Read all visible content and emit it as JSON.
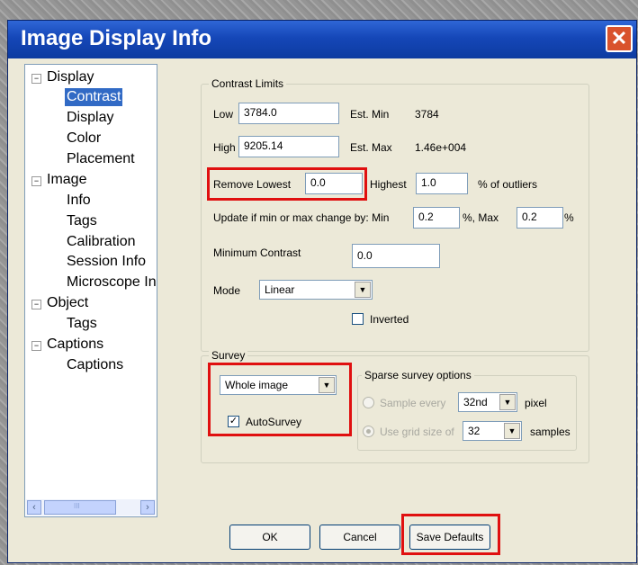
{
  "window": {
    "title": "Image Display Info",
    "close_label": "✕"
  },
  "tree": {
    "items": [
      {
        "label": "Display",
        "toggle": "−"
      },
      {
        "label": "Contrast"
      },
      {
        "label": "Display"
      },
      {
        "label": "Color"
      },
      {
        "label": "Placement"
      },
      {
        "label": "Image",
        "toggle": "−"
      },
      {
        "label": "Info"
      },
      {
        "label": "Tags"
      },
      {
        "label": "Calibration"
      },
      {
        "label": "Session Info"
      },
      {
        "label": "Microscope In"
      },
      {
        "label": "Object",
        "toggle": "−"
      },
      {
        "label": "Tags"
      },
      {
        "label": "Captions",
        "toggle": "−"
      },
      {
        "label": "Captions"
      }
    ],
    "scroll_left": "‹",
    "scroll_right": "›",
    "scroll_grip": "III"
  },
  "contrast": {
    "legend": "Contrast Limits",
    "low_label": "Low",
    "low_value": "3784.0",
    "est_min_label": "Est. Min",
    "est_min_value": "3784",
    "high_label": "High",
    "high_value": "9205.14",
    "est_max_label": "Est. Max",
    "est_max_value": "1.46e+004",
    "remove_lowest_label": "Remove Lowest",
    "remove_lowest_value": "0.0",
    "highest_label": "Highest",
    "highest_value": "1.0",
    "outliers_label": "% of outliers",
    "update_label": "Update if min or max change by: Min",
    "update_min_value": "0.2",
    "update_max_label": "%,  Max",
    "update_max_value": "0.2",
    "update_pct": "%",
    "min_contrast_label": "Minimum Contrast",
    "min_contrast_value": "0.0",
    "mode_label": "Mode",
    "mode_value": "Linear",
    "inverted_label": "Inverted"
  },
  "survey": {
    "legend": "Survey",
    "scope_value": "Whole image",
    "autosurvey_label": "AutoSurvey",
    "autosurvey_check": "✓",
    "sparse_legend": "Sparse survey options",
    "sample_every_label": "Sample every",
    "sample_every_value": "32nd",
    "pixel_label": "pixel",
    "grid_size_label": "Use grid size of",
    "grid_size_value": "32",
    "samples_label": "samples"
  },
  "buttons": {
    "ok": "OK",
    "cancel": "Cancel",
    "save_defaults": "Save Defaults"
  },
  "dropdown_arrow": "▼",
  "colors": {
    "titlebar": "#1547b8",
    "selection": "#316ac5",
    "highlight": "#e01010",
    "dialog_bg": "#ece9d8"
  }
}
